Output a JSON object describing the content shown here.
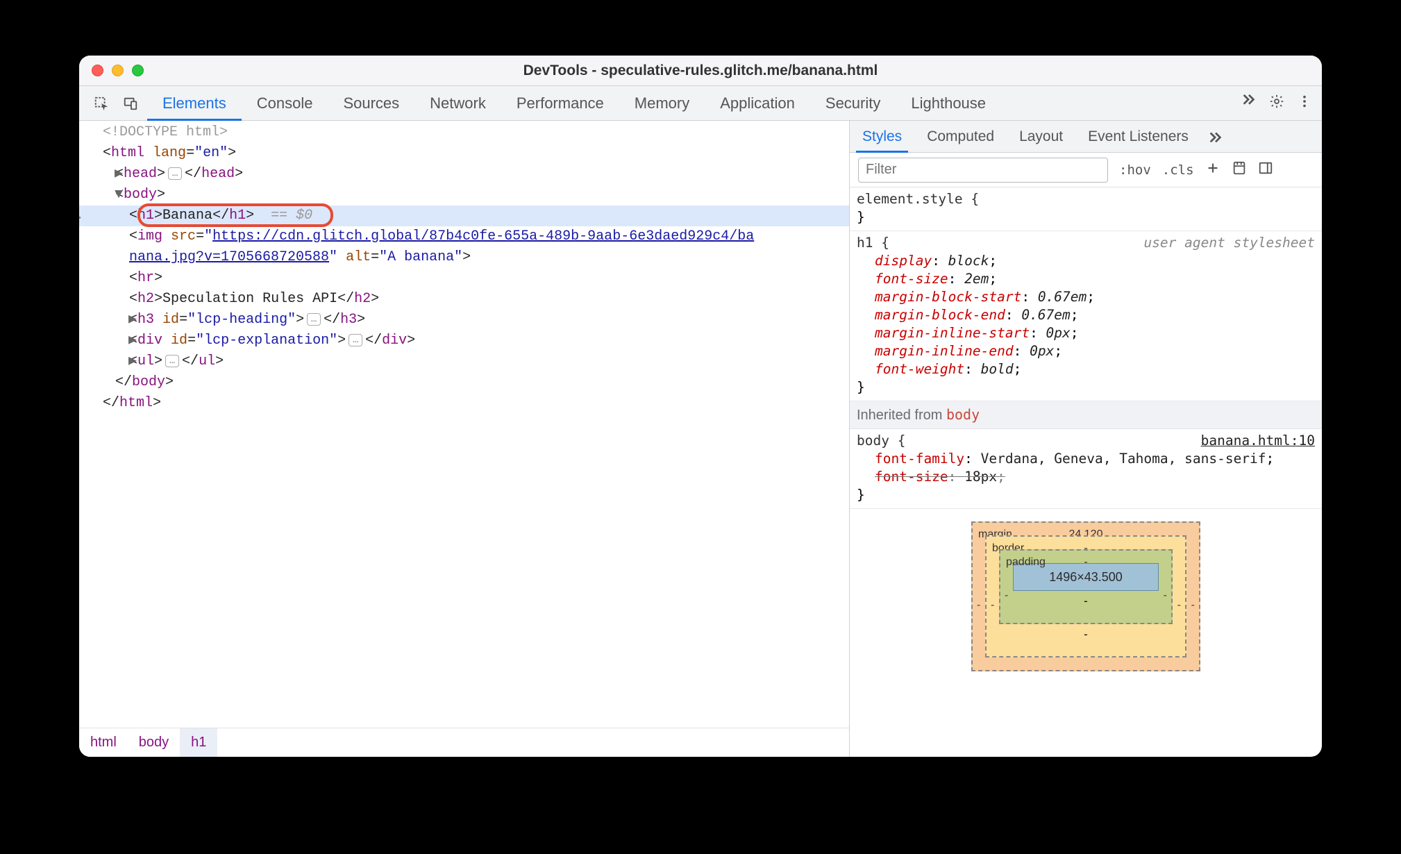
{
  "window": {
    "title": "DevTools - speculative-rules.glitch.me/banana.html"
  },
  "mainTabs": [
    "Elements",
    "Console",
    "Sources",
    "Network",
    "Performance",
    "Memory",
    "Application",
    "Security",
    "Lighthouse"
  ],
  "activeMainTab": 0,
  "dom": {
    "doctype": "<!DOCTYPE html>",
    "htmlOpen": "html",
    "htmlLangAttr": "lang",
    "htmlLangVal": "\"en\"",
    "headOpen": "head",
    "headClose": "head",
    "bodyOpen": "body",
    "h1Open": "h1",
    "h1Text": "Banana",
    "h1Close": "h1",
    "selBadge": "== $0",
    "imgOpen": "img",
    "srcAttr": "src",
    "srcValPre": "\"",
    "srcUrl1": "https://cdn.glitch.global/87b4c0fe-655a-489b-9aab-6e3daed929c4/ba",
    "srcUrl2": "nana.jpg?v=1705668720588",
    "srcValPost": "\"",
    "altAttr": "alt",
    "altVal": "\"A banana\"",
    "hr": "hr",
    "h2Open": "h2",
    "h2Text": "Speculation Rules API",
    "h2Close": "h2",
    "h3Open": "h3",
    "h3IdAttr": "id",
    "h3IdVal": "\"lcp-heading\"",
    "h3Close": "h3",
    "divOpen": "div",
    "divIdAttr": "id",
    "divIdVal": "\"lcp-explanation\"",
    "divClose": "div",
    "ulOpen": "ul",
    "ulClose": "ul",
    "bodyClose": "body",
    "htmlClose": "html",
    "dots": "…"
  },
  "breadcrumbs": [
    "html",
    "body",
    "h1"
  ],
  "stylesTabs": [
    "Styles",
    "Computed",
    "Layout",
    "Event Listeners"
  ],
  "activeStylesTab": 0,
  "filterPlaceholder": "Filter",
  "hovLabel": ":hov",
  "clsLabel": ".cls",
  "rules": {
    "elementStyleSelector": "element.style",
    "h1Selector": "h1",
    "uaNote": "user agent stylesheet",
    "h1Props": [
      {
        "p": "display",
        "v": "block"
      },
      {
        "p": "font-size",
        "v": "2em"
      },
      {
        "p": "margin-block-start",
        "v": "0.67em"
      },
      {
        "p": "margin-block-end",
        "v": "0.67em"
      },
      {
        "p": "margin-inline-start",
        "v": "0px"
      },
      {
        "p": "margin-inline-end",
        "v": "0px"
      },
      {
        "p": "font-weight",
        "v": "bold"
      }
    ],
    "inheritedLabel": "Inherited from",
    "inheritedFrom": "body",
    "bodySelector": "body",
    "bodySource": "banana.html:10",
    "bodyProps": [
      {
        "p": "font-family",
        "v": "Verdana, Geneva, Tahoma, sans-serif",
        "struck": false
      },
      {
        "p": "font-size",
        "v": "18px",
        "struck": true
      }
    ]
  },
  "boxModel": {
    "marginLabel": "margin",
    "marginTop": "24.120",
    "borderLabel": "border",
    "paddingLabel": "padding",
    "contentSize": "1496×43.500"
  }
}
